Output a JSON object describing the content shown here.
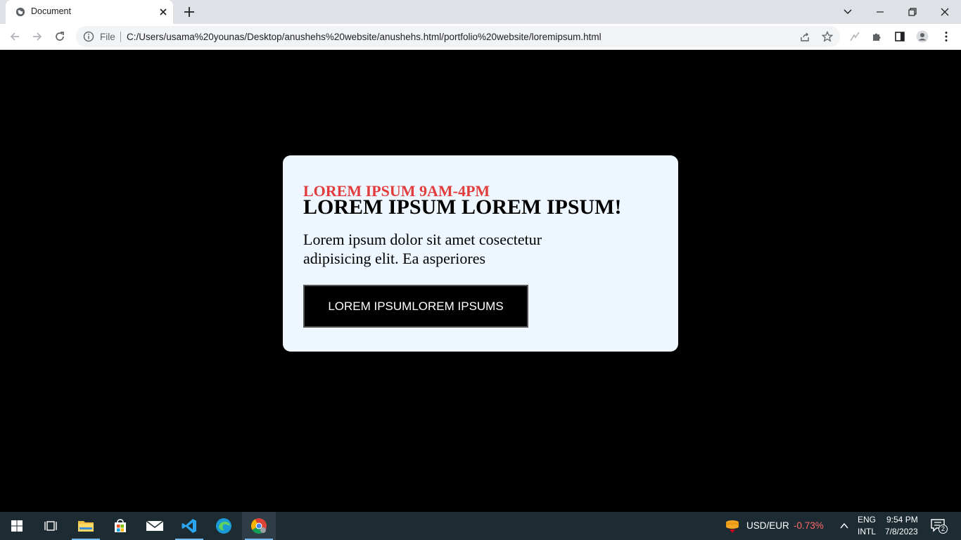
{
  "browser": {
    "tab_title": "Document",
    "omnibox_scheme": "File",
    "url": "C:/Users/usama%20younas/Desktop/anushehs%20website/anushehs.html/portfolio%20website/loremipsum.html"
  },
  "card": {
    "kicker": "LOREM IPSUM 9AM-4PM",
    "title": "LOREM IPSUM LOREM IPSUM!",
    "text": "Lorem ipsum dolor sit amet cosectetur adipisicing elit. Ea asperiores",
    "button_label": "LOREM IPSUMLOREM IPSUMS"
  },
  "taskbar": {
    "ticker_label": "USD/EUR",
    "ticker_change": "-0.73%",
    "lang_top": "ENG",
    "lang_bottom": "INTL",
    "time": "9:54 PM",
    "date": "7/8/2023",
    "notification_count": "2"
  },
  "colors": {
    "kicker": "#e23c3c",
    "card_bg": "#eef6ff",
    "ticker_change": "#ff6b6b",
    "taskbar_bg": "#1d2b33"
  }
}
